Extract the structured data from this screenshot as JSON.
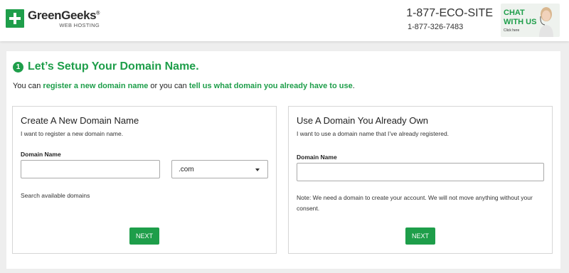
{
  "header": {
    "logo_name": "GreenGeeks",
    "logo_mark": "®",
    "logo_sub": "WEB HOSTING",
    "phone_main": "1-877-ECO-SITE",
    "phone_sub": "1-877-326-7483",
    "chat_line1": "CHAT",
    "chat_line2": "WITH US",
    "chat_line3": "Click here"
  },
  "step": {
    "number": "1",
    "title": "Let’s Setup Your Domain Name."
  },
  "intro": {
    "part1": "You can ",
    "link1": "register a new domain name",
    "part2": " or you can ",
    "link2": "tell us what domain you already have to use",
    "part3": "."
  },
  "new_domain": {
    "title": "Create A New Domain Name",
    "description": "I want to register a new domain name.",
    "field_label": "Domain Name",
    "input_value": "",
    "tld_selected": ".com",
    "search_hint": "Search available domains",
    "button": "NEXT"
  },
  "existing_domain": {
    "title": "Use A Domain You Already Own",
    "description": "I want to use a domain name that I’ve already registered.",
    "field_label": "Domain Name",
    "input_value": "",
    "note": "Note: We need a domain to create your account. We will not move anything without your consent.",
    "button": "NEXT"
  },
  "colors": {
    "accent": "#1e9e4a",
    "background": "#eeeeee"
  }
}
